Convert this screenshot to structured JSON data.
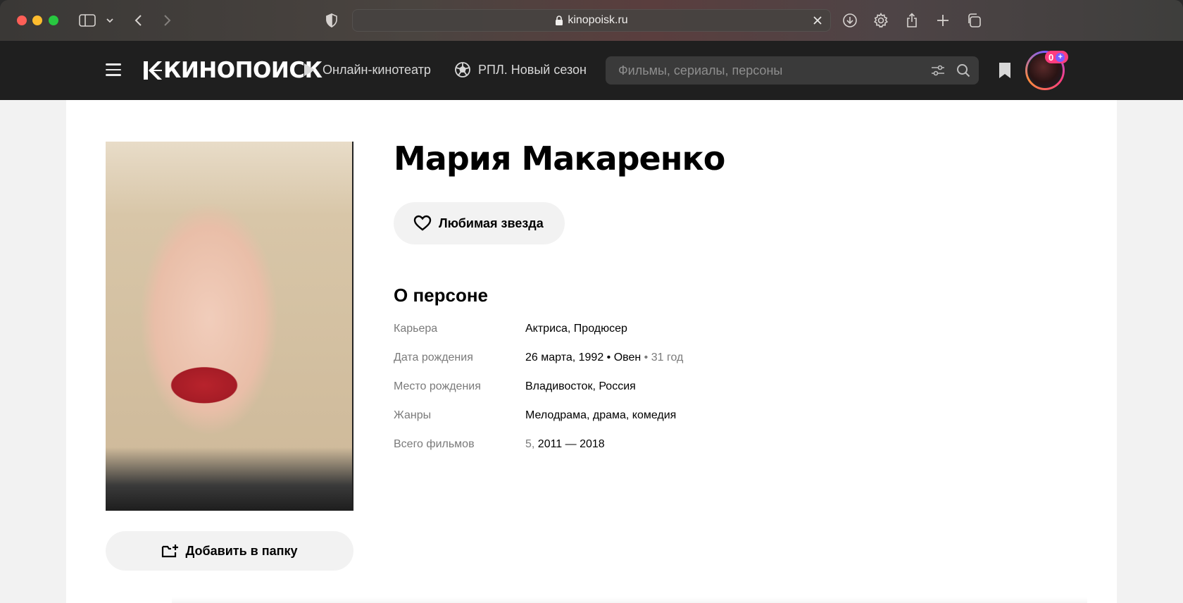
{
  "browser": {
    "url": "kinopoisk.ru"
  },
  "header": {
    "logo_text": "КИНОПОИСК",
    "nav": [
      {
        "label": "Онлайн-кинотеатр",
        "icon": "play-icon"
      },
      {
        "label": "РПЛ. Новый сезон",
        "icon": "football-icon"
      }
    ],
    "search_placeholder": "Фильмы, сериалы, персоны",
    "notification_count": "0"
  },
  "person": {
    "name": "Мария Макаренко",
    "favorite_label": "Любимая звезда",
    "add_to_folder_label": "Добавить в папку",
    "about_title": "О персоне",
    "details": [
      {
        "label": "Карьера",
        "value": "Актриса, Продюсер"
      },
      {
        "label": "Дата рождения",
        "value": "26 марта, 1992 • Овен",
        "extra": " • 31 год"
      },
      {
        "label": "Место рождения",
        "value": "Владивосток, Россия"
      },
      {
        "label": "Жанры",
        "value": "Мелодрама, драма, комедия"
      },
      {
        "label": "Всего фильмов",
        "prefix": "5, ",
        "value": "2011 — 2018"
      }
    ]
  },
  "colors": {
    "header_bg": "#1f1f1f",
    "accent_pink": "#ff3d7f",
    "accent_purple": "#7c5cff",
    "button_bg": "#f2f2f2"
  }
}
